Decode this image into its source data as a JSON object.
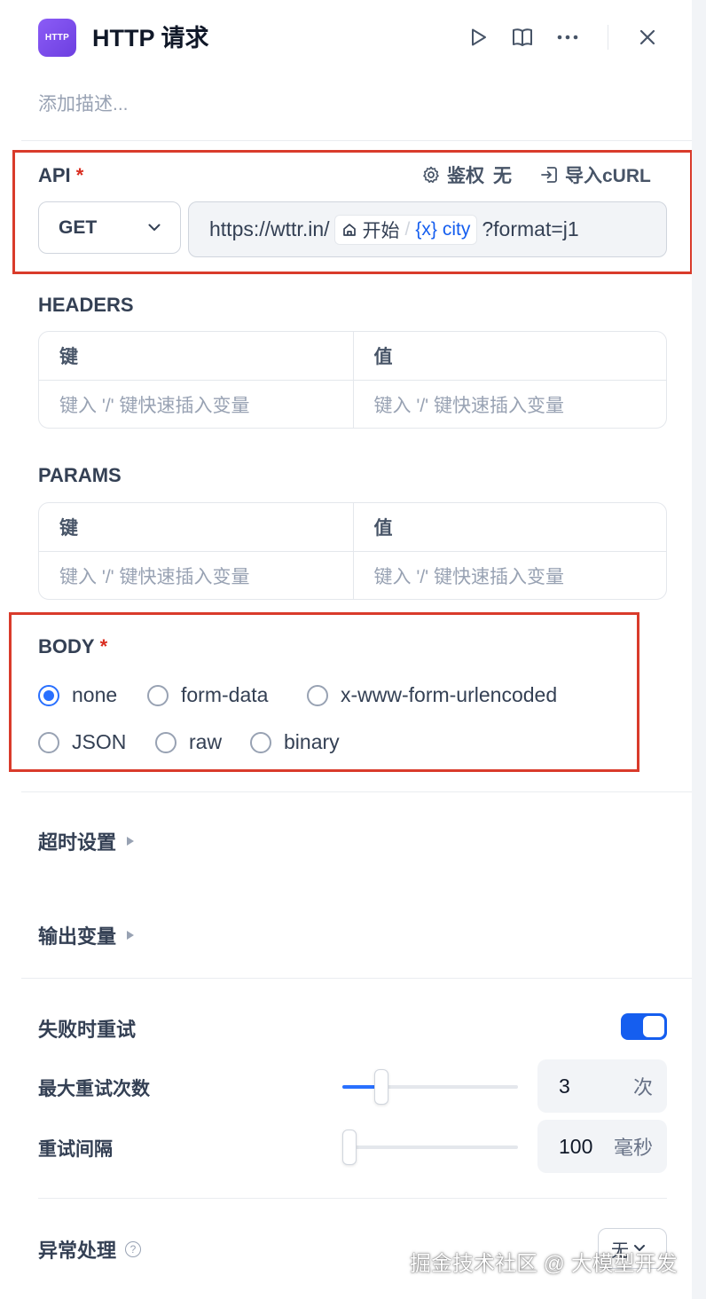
{
  "header": {
    "icon_text": "HTTP",
    "title": "HTTP 请求",
    "description_placeholder": "添加描述..."
  },
  "api": {
    "label": "API",
    "required_mark": "*",
    "auth_label": "鉴权",
    "auth_value": "无",
    "import_label": "导入cURL",
    "method": "GET",
    "url_prefix": "https://wttr.in/",
    "var_node": "开始",
    "var_name": "city",
    "url_suffix": "?format=j1"
  },
  "headers": {
    "label": "HEADERS",
    "key_header": "键",
    "value_header": "值",
    "key_placeholder": "键入 '/' 键快速插入变量",
    "value_placeholder": "键入 '/' 键快速插入变量"
  },
  "params": {
    "label": "PARAMS",
    "key_header": "键",
    "value_header": "值",
    "key_placeholder": "键入 '/' 键快速插入变量",
    "value_placeholder": "键入 '/' 键快速插入变量"
  },
  "body": {
    "label": "BODY",
    "required_mark": "*",
    "options": [
      "none",
      "form-data",
      "x-www-form-urlencoded",
      "JSON",
      "raw",
      "binary"
    ],
    "selected": "none"
  },
  "timeout": {
    "label": "超时设置"
  },
  "output_vars": {
    "label": "输出变量"
  },
  "retry": {
    "label": "失败时重试",
    "enabled": true,
    "max_retries_label": "最大重试次数",
    "max_retries_value": "3",
    "max_retries_unit": "次",
    "max_retries_slider": 0.2,
    "interval_label": "重试间隔",
    "interval_value": "100",
    "interval_unit": "毫秒",
    "interval_slider": 0.0
  },
  "error_handling": {
    "label": "异常处理",
    "help_icon": "?",
    "value": "无"
  },
  "watermark": "掘金技术社区 @ 大模型开发",
  "colors": {
    "accent": "#155eef",
    "highlight_box": "#d93b2b",
    "icon_gradient_start": "#8b5cf6"
  }
}
